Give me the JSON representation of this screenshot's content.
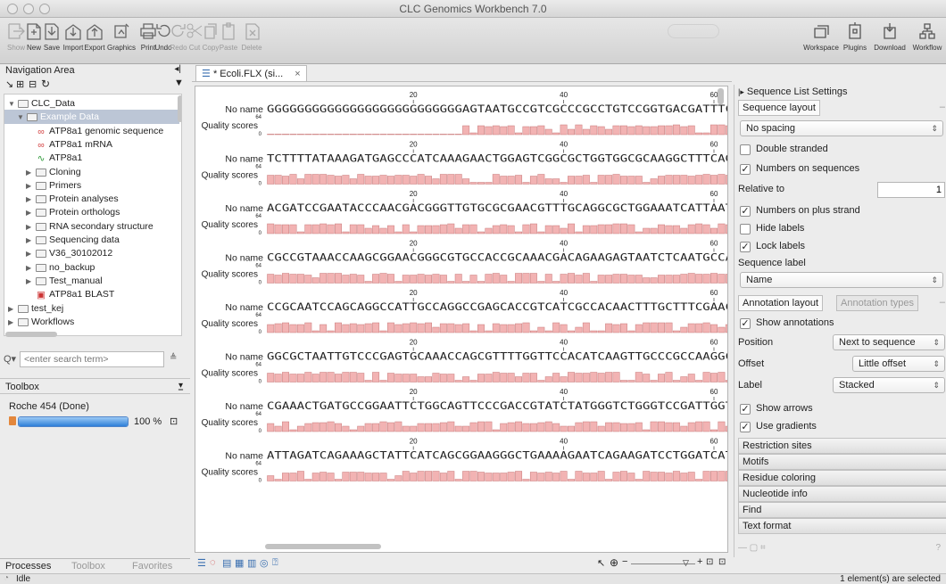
{
  "window": {
    "title": "CLC Genomics Workbench 7.0"
  },
  "toolbar": {
    "show_label": "Show",
    "new_label": "New",
    "save_label": "Save",
    "import_label": "Import",
    "export_label": "Export",
    "graphics_label": "Graphics",
    "print_label": "Print",
    "undo_label": "Undo",
    "redo_label": "Redo",
    "cut_label": "Cut",
    "copy_label": "Copy",
    "paste_label": "Paste",
    "delete_label": "Delete",
    "workspace_label": "Workspace",
    "plugins_label": "Plugins",
    "download_label": "Download",
    "workflow_label": "Workflow"
  },
  "navigation": {
    "title": "Navigation Area",
    "tree": [
      {
        "label": "CLC_Data",
        "level": 0,
        "icon": "folder",
        "twisty": "open"
      },
      {
        "label": "Example Data",
        "level": 1,
        "icon": "folder",
        "twisty": "open",
        "selected": true
      },
      {
        "label": "ATP8a1 genomic sequence",
        "level": 2,
        "icon": "sequence-red"
      },
      {
        "label": "ATP8a1 mRNA",
        "level": 2,
        "icon": "sequence-red"
      },
      {
        "label": "ATP8a1",
        "level": 2,
        "icon": "sequence-green"
      },
      {
        "label": "Cloning",
        "level": 2,
        "icon": "folder",
        "twisty": "closed"
      },
      {
        "label": "Primers",
        "level": 2,
        "icon": "folder",
        "twisty": "closed"
      },
      {
        "label": "Protein analyses",
        "level": 2,
        "icon": "folder",
        "twisty": "closed"
      },
      {
        "label": "Protein orthologs",
        "level": 2,
        "icon": "folder",
        "twisty": "closed"
      },
      {
        "label": "RNA secondary structure",
        "level": 2,
        "icon": "folder",
        "twisty": "closed"
      },
      {
        "label": "Sequencing data",
        "level": 2,
        "icon": "folder",
        "twisty": "closed"
      },
      {
        "label": "V36_30102012",
        "level": 2,
        "icon": "folder",
        "twisty": "closed"
      },
      {
        "label": "no_backup",
        "level": 2,
        "icon": "folder",
        "twisty": "closed"
      },
      {
        "label": "Test_manual",
        "level": 2,
        "icon": "folder",
        "twisty": "closed"
      },
      {
        "label": "ATP8a1 BLAST",
        "level": 2,
        "icon": "blast"
      },
      {
        "label": "test_kej",
        "level": 0,
        "icon": "folder",
        "twisty": "closed"
      },
      {
        "label": "Workflows",
        "level": 0,
        "icon": "folder",
        "twisty": "closed"
      }
    ],
    "search_placeholder": "<enter search term>"
  },
  "toolbox": {
    "title": "Toolbox",
    "process_name": "Roche 454 (Done)",
    "progress": 100,
    "progress_label": "100 %"
  },
  "bottom_tabs": [
    "Processes",
    "Toolbox",
    "Favorites"
  ],
  "status": {
    "left": "Idle",
    "right": "1 element(s) are selected"
  },
  "editor": {
    "tab_label": "* Ecoli.FLX (si...",
    "name_label": "No name",
    "quality_label": "Quality scores",
    "quality_scale_top": "64",
    "quality_scale_bottom": "0",
    "ruler_ticks": [
      "20",
      "40",
      "60"
    ],
    "sequences": [
      "GGGGGGGGGGGGGGGGGGGGGGGGGGAGTAATGCCGTCGCCCGCCTGTCCGGTGACGATTTC",
      "TCTTTTATAAAGATGAGCCCATCAAAGAACTGGAGTCGGCGCTGGTGGCGCAAGGCTTTCAG",
      "ACGATCCGAATACCCAACGACGGGTTGTGCGCGAACGTTTGCAGGCGCTGGAAATCATTAAT",
      "CGCCGTAAACCAAGCGGAACGGGCGTGCCACCGCAAACGACAGAAGAGTAATCTCAATGCCA",
      "CCGCAATCCAGCAGGCCATTGCCAGGCCGAGCACCGTCATCGCCACAACTTTGCTTTCGAAC",
      "GGCGCTAATTGTCCCGAGTGCAAACCAGCGTTTTGGTTCCACATCAAGTTGCCCGCCAAGGC",
      "CGAAACTGATGCCGGAATTCTGGCAGTTCCCGACCGTATCTATGGGTCTGGGTCCGATTGGT",
      "ATTAGATCAGAAAGCTATTCATCAGCGGAAGGGCTGAAAAGAATCAGAAGATCCTGGATCAT"
    ]
  },
  "settings": {
    "header": "Sequence List Settings",
    "sequence_layout_tab": "Sequence layout",
    "spacing_value": "No spacing",
    "double_stranded": {
      "label": "Double stranded",
      "checked": false
    },
    "numbers_on_sequences": {
      "label": "Numbers on sequences",
      "checked": true
    },
    "relative_to_label": "Relative to",
    "relative_to_value": "1",
    "numbers_on_plus": {
      "label": "Numbers on plus strand",
      "checked": true
    },
    "hide_labels": {
      "label": "Hide labels",
      "checked": false
    },
    "lock_labels": {
      "label": "Lock labels",
      "checked": true
    },
    "sequence_label_title": "Sequence label",
    "sequence_label_value": "Name",
    "annotation_layout_tab": "Annotation layout",
    "annotation_types_tab": "Annotation types",
    "show_annotations": {
      "label": "Show annotations",
      "checked": true
    },
    "position_label": "Position",
    "position_value": "Next to sequence",
    "offset_label": "Offset",
    "offset_value": "Little offset",
    "label_label": "Label",
    "label_value": "Stacked",
    "show_arrows": {
      "label": "Show arrows",
      "checked": true
    },
    "use_gradients": {
      "label": "Use gradients",
      "checked": true
    },
    "sections": [
      "Restriction sites",
      "Motifs",
      "Residue coloring",
      "Nucleotide info",
      "Find",
      "Text format"
    ]
  },
  "colors": {
    "quality_bar": "#f2b3b3",
    "quality_bar_stroke": "#c77a7a",
    "selection": "#bcc6d6",
    "progress": "#2d7fd8"
  }
}
